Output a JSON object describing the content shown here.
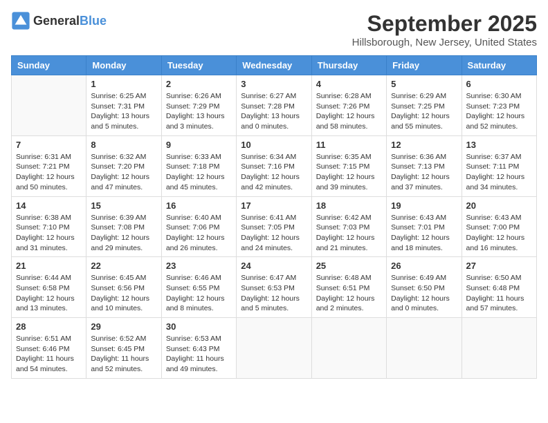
{
  "logo": {
    "general": "General",
    "blue": "Blue"
  },
  "title": "September 2025",
  "location": "Hillsborough, New Jersey, United States",
  "days_of_week": [
    "Sunday",
    "Monday",
    "Tuesday",
    "Wednesday",
    "Thursday",
    "Friday",
    "Saturday"
  ],
  "weeks": [
    [
      {
        "day": "",
        "content": ""
      },
      {
        "day": "1",
        "content": "Sunrise: 6:25 AM\nSunset: 7:31 PM\nDaylight: 13 hours\nand 5 minutes."
      },
      {
        "day": "2",
        "content": "Sunrise: 6:26 AM\nSunset: 7:29 PM\nDaylight: 13 hours\nand 3 minutes."
      },
      {
        "day": "3",
        "content": "Sunrise: 6:27 AM\nSunset: 7:28 PM\nDaylight: 13 hours\nand 0 minutes."
      },
      {
        "day": "4",
        "content": "Sunrise: 6:28 AM\nSunset: 7:26 PM\nDaylight: 12 hours\nand 58 minutes."
      },
      {
        "day": "5",
        "content": "Sunrise: 6:29 AM\nSunset: 7:25 PM\nDaylight: 12 hours\nand 55 minutes."
      },
      {
        "day": "6",
        "content": "Sunrise: 6:30 AM\nSunset: 7:23 PM\nDaylight: 12 hours\nand 52 minutes."
      }
    ],
    [
      {
        "day": "7",
        "content": "Sunrise: 6:31 AM\nSunset: 7:21 PM\nDaylight: 12 hours\nand 50 minutes."
      },
      {
        "day": "8",
        "content": "Sunrise: 6:32 AM\nSunset: 7:20 PM\nDaylight: 12 hours\nand 47 minutes."
      },
      {
        "day": "9",
        "content": "Sunrise: 6:33 AM\nSunset: 7:18 PM\nDaylight: 12 hours\nand 45 minutes."
      },
      {
        "day": "10",
        "content": "Sunrise: 6:34 AM\nSunset: 7:16 PM\nDaylight: 12 hours\nand 42 minutes."
      },
      {
        "day": "11",
        "content": "Sunrise: 6:35 AM\nSunset: 7:15 PM\nDaylight: 12 hours\nand 39 minutes."
      },
      {
        "day": "12",
        "content": "Sunrise: 6:36 AM\nSunset: 7:13 PM\nDaylight: 12 hours\nand 37 minutes."
      },
      {
        "day": "13",
        "content": "Sunrise: 6:37 AM\nSunset: 7:11 PM\nDaylight: 12 hours\nand 34 minutes."
      }
    ],
    [
      {
        "day": "14",
        "content": "Sunrise: 6:38 AM\nSunset: 7:10 PM\nDaylight: 12 hours\nand 31 minutes."
      },
      {
        "day": "15",
        "content": "Sunrise: 6:39 AM\nSunset: 7:08 PM\nDaylight: 12 hours\nand 29 minutes."
      },
      {
        "day": "16",
        "content": "Sunrise: 6:40 AM\nSunset: 7:06 PM\nDaylight: 12 hours\nand 26 minutes."
      },
      {
        "day": "17",
        "content": "Sunrise: 6:41 AM\nSunset: 7:05 PM\nDaylight: 12 hours\nand 24 minutes."
      },
      {
        "day": "18",
        "content": "Sunrise: 6:42 AM\nSunset: 7:03 PM\nDaylight: 12 hours\nand 21 minutes."
      },
      {
        "day": "19",
        "content": "Sunrise: 6:43 AM\nSunset: 7:01 PM\nDaylight: 12 hours\nand 18 minutes."
      },
      {
        "day": "20",
        "content": "Sunrise: 6:43 AM\nSunset: 7:00 PM\nDaylight: 12 hours\nand 16 minutes."
      }
    ],
    [
      {
        "day": "21",
        "content": "Sunrise: 6:44 AM\nSunset: 6:58 PM\nDaylight: 12 hours\nand 13 minutes."
      },
      {
        "day": "22",
        "content": "Sunrise: 6:45 AM\nSunset: 6:56 PM\nDaylight: 12 hours\nand 10 minutes."
      },
      {
        "day": "23",
        "content": "Sunrise: 6:46 AM\nSunset: 6:55 PM\nDaylight: 12 hours\nand 8 minutes."
      },
      {
        "day": "24",
        "content": "Sunrise: 6:47 AM\nSunset: 6:53 PM\nDaylight: 12 hours\nand 5 minutes."
      },
      {
        "day": "25",
        "content": "Sunrise: 6:48 AM\nSunset: 6:51 PM\nDaylight: 12 hours\nand 2 minutes."
      },
      {
        "day": "26",
        "content": "Sunrise: 6:49 AM\nSunset: 6:50 PM\nDaylight: 12 hours\nand 0 minutes."
      },
      {
        "day": "27",
        "content": "Sunrise: 6:50 AM\nSunset: 6:48 PM\nDaylight: 11 hours\nand 57 minutes."
      }
    ],
    [
      {
        "day": "28",
        "content": "Sunrise: 6:51 AM\nSunset: 6:46 PM\nDaylight: 11 hours\nand 54 minutes."
      },
      {
        "day": "29",
        "content": "Sunrise: 6:52 AM\nSunset: 6:45 PM\nDaylight: 11 hours\nand 52 minutes."
      },
      {
        "day": "30",
        "content": "Sunrise: 6:53 AM\nSunset: 6:43 PM\nDaylight: 11 hours\nand 49 minutes."
      },
      {
        "day": "",
        "content": ""
      },
      {
        "day": "",
        "content": ""
      },
      {
        "day": "",
        "content": ""
      },
      {
        "day": "",
        "content": ""
      }
    ]
  ]
}
